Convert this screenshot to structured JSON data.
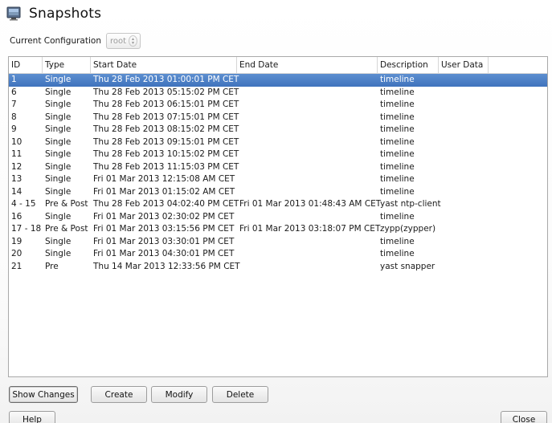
{
  "window": {
    "title": "Snapshots",
    "icon": "snapshots-app-icon"
  },
  "config": {
    "label": "Current Configuration",
    "selected": "root"
  },
  "table": {
    "columns": [
      "ID",
      "Type",
      "Start Date",
      "End Date",
      "Description",
      "User Data"
    ],
    "rows": [
      {
        "id": "1",
        "type": "Single",
        "start": "Thu 28 Feb 2013 01:00:01 PM CET",
        "end": "",
        "desc": "timeline",
        "user": "",
        "selected": true
      },
      {
        "id": "6",
        "type": "Single",
        "start": "Thu 28 Feb 2013 05:15:02 PM CET",
        "end": "",
        "desc": "timeline",
        "user": ""
      },
      {
        "id": "7",
        "type": "Single",
        "start": "Thu 28 Feb 2013 06:15:01 PM CET",
        "end": "",
        "desc": "timeline",
        "user": ""
      },
      {
        "id": "8",
        "type": "Single",
        "start": "Thu 28 Feb 2013 07:15:01 PM CET",
        "end": "",
        "desc": "timeline",
        "user": ""
      },
      {
        "id": "9",
        "type": "Single",
        "start": "Thu 28 Feb 2013 08:15:02 PM CET",
        "end": "",
        "desc": "timeline",
        "user": ""
      },
      {
        "id": "10",
        "type": "Single",
        "start": "Thu 28 Feb 2013 09:15:01 PM CET",
        "end": "",
        "desc": "timeline",
        "user": ""
      },
      {
        "id": "11",
        "type": "Single",
        "start": "Thu 28 Feb 2013 10:15:02 PM CET",
        "end": "",
        "desc": "timeline",
        "user": ""
      },
      {
        "id": "12",
        "type": "Single",
        "start": "Thu 28 Feb 2013 11:15:03 PM CET",
        "end": "",
        "desc": "timeline",
        "user": ""
      },
      {
        "id": "13",
        "type": "Single",
        "start": "Fri 01 Mar 2013 12:15:08 AM CET",
        "end": "",
        "desc": "timeline",
        "user": ""
      },
      {
        "id": "14",
        "type": "Single",
        "start": "Fri 01 Mar 2013 01:15:02 AM CET",
        "end": "",
        "desc": "timeline",
        "user": ""
      },
      {
        "id": "4 - 15",
        "type": "Pre & Post",
        "start": "Thu 28 Feb 2013 04:02:40 PM CET",
        "end": "Fri 01 Mar 2013 01:48:43 AM CET",
        "desc": "yast ntp-client",
        "user": ""
      },
      {
        "id": "16",
        "type": "Single",
        "start": "Fri 01 Mar 2013 02:30:02 PM CET",
        "end": "",
        "desc": "timeline",
        "user": ""
      },
      {
        "id": "17 - 18",
        "type": "Pre & Post",
        "start": "Fri 01 Mar 2013 03:15:56 PM CET",
        "end": "Fri 01 Mar 2013 03:18:07 PM CET",
        "desc": "zypp(zypper)",
        "user": ""
      },
      {
        "id": "19",
        "type": "Single",
        "start": "Fri 01 Mar 2013 03:30:01 PM CET",
        "end": "",
        "desc": "timeline",
        "user": ""
      },
      {
        "id": "20",
        "type": "Single",
        "start": "Fri 01 Mar 2013 04:30:01 PM CET",
        "end": "",
        "desc": "timeline",
        "user": ""
      },
      {
        "id": "21",
        "type": "Pre",
        "start": "Thu 14 Mar 2013 12:33:56 PM CET",
        "end": "",
        "desc": "yast snapper",
        "user": ""
      }
    ]
  },
  "buttons": {
    "show_changes": "Show Changes",
    "create": "Create",
    "modify": "Modify",
    "delete": "Delete",
    "help": "Help",
    "close": "Close"
  },
  "colors": {
    "selection": "#4a7ec4"
  }
}
